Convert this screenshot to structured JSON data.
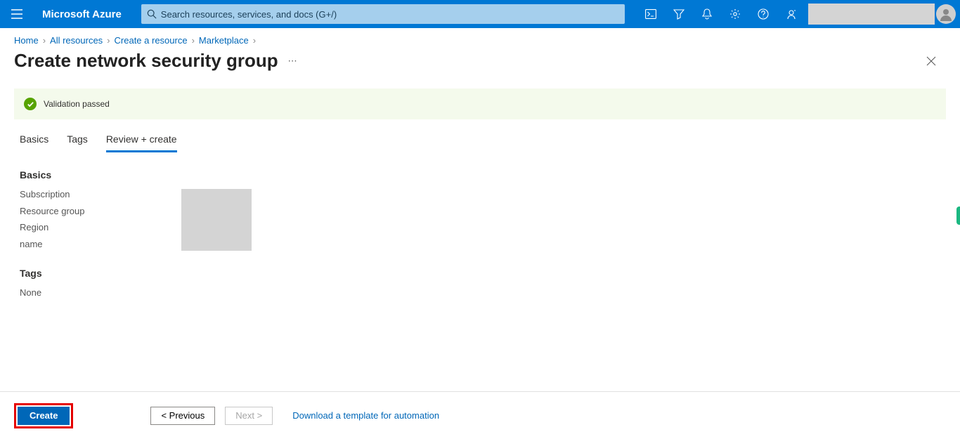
{
  "header": {
    "brand": "Microsoft Azure",
    "search_placeholder": "Search resources, services, and docs (G+/)"
  },
  "breadcrumbs": [
    {
      "label": "Home"
    },
    {
      "label": "All resources"
    },
    {
      "label": "Create a resource"
    },
    {
      "label": "Marketplace"
    }
  ],
  "page": {
    "title": "Create network security group",
    "validation_message": "Validation passed"
  },
  "tabs": [
    {
      "label": "Basics"
    },
    {
      "label": "Tags"
    },
    {
      "label": "Review + create"
    }
  ],
  "basics": {
    "heading": "Basics",
    "rows": [
      {
        "label": "Subscription"
      },
      {
        "label": "Resource group"
      },
      {
        "label": "Region"
      },
      {
        "label": "name"
      }
    ]
  },
  "tags_section": {
    "heading": "Tags",
    "value": "None"
  },
  "footer": {
    "create": "Create",
    "previous": "<  Previous",
    "next": "Next  >",
    "download_link": "Download a template for automation"
  }
}
